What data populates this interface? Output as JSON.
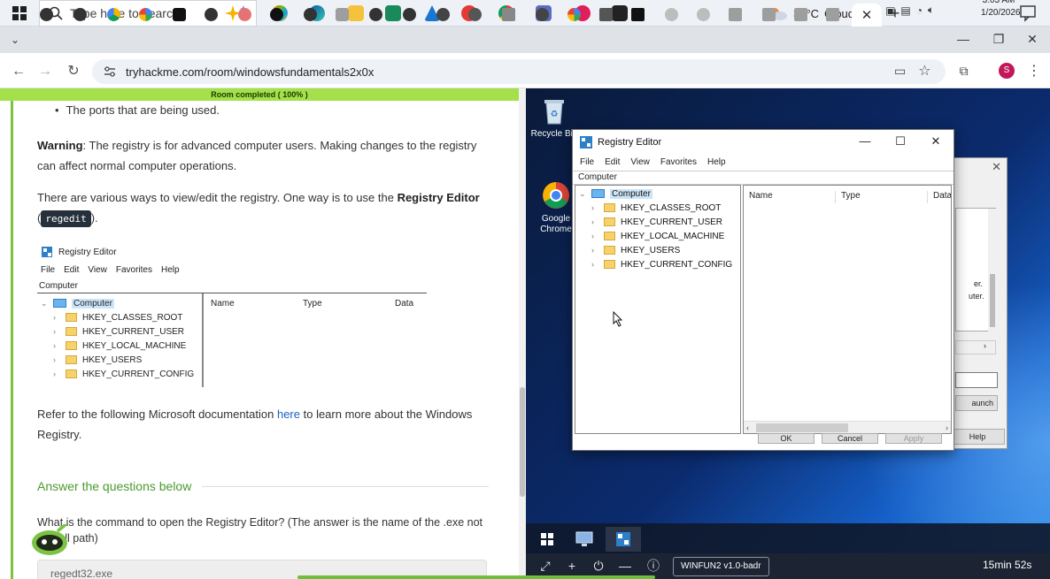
{
  "taskbar": {
    "search_placeholder": "Type here to search",
    "weather_temp": "32°C",
    "weather_desc": "Cloudy",
    "clock_time": "3:03 AM",
    "clock_date": "1/20/2026"
  },
  "browser": {
    "url": "tryhackme.com/room/windowsfundamentals2x0x",
    "active_tab_close": "✕",
    "new_tab": "+",
    "minimize": "—",
    "restore": "❐",
    "close": "✕",
    "profile_initial": "S"
  },
  "page": {
    "progress_label": "Room completed ( 100% )",
    "bullet_item": "The ports that are being used.",
    "warning_label": "Warning",
    "warning_text": ": The registry is for advanced computer users. Making changes to the registry can affect normal computer operations.",
    "intro_text_pre": "There are various ways to view/edit the registry. One way is to use the ",
    "intro_bold": "Registry Editor",
    "intro_open": " (",
    "intro_code": "regedit",
    "intro_close": ").",
    "refer_pre": "Refer to the following Microsoft documentation ",
    "refer_link": "here",
    "refer_post": " to learn more about the Windows Registry.",
    "answer_heading": "Answer the questions below",
    "question_text": "What is the command to open the Registry Editor? (The answer is the name of  the .exe not the full path)",
    "answer_value": "regedt32.exe",
    "regimg": {
      "title": "Registry Editor",
      "menu": [
        "File",
        "Edit",
        "View",
        "Favorites",
        "Help"
      ],
      "address": "Computer",
      "root": "Computer",
      "hives": [
        "HKEY_CLASSES_ROOT",
        "HKEY_CURRENT_USER",
        "HKEY_LOCAL_MACHINE",
        "HKEY_USERS",
        "HKEY_CURRENT_CONFIG"
      ],
      "columns": [
        "Name",
        "Type",
        "Data"
      ]
    }
  },
  "vm": {
    "recycle_bin_label": "Recycle Bin",
    "chrome_label": "Google Chrome",
    "regedit": {
      "title": "Registry Editor",
      "menu": [
        "File",
        "Edit",
        "View",
        "Favorites",
        "Help"
      ],
      "address": "Computer",
      "root": "Computer",
      "hives": [
        "HKEY_CLASSES_ROOT",
        "HKEY_CURRENT_USER",
        "HKEY_LOCAL_MACHINE",
        "HKEY_USERS",
        "HKEY_CURRENT_CONFIG"
      ],
      "columns": [
        "Name",
        "Type",
        "Data"
      ]
    },
    "run_dialog": {
      "text_line1": "er.",
      "text_line2": "uter.",
      "launch_label": "aunch",
      "help_label": "Help"
    },
    "bg_buttons": [
      "OK",
      "Cancel",
      "Apply"
    ],
    "machine_name": "WINFUN2 v1.0-badr",
    "timer": "15min 52s"
  },
  "colors": {
    "progress": "#a3e04a",
    "accent_green": "#4a9a2f",
    "link": "#1d5fbf",
    "vm_bg": "#0b2b6e"
  }
}
